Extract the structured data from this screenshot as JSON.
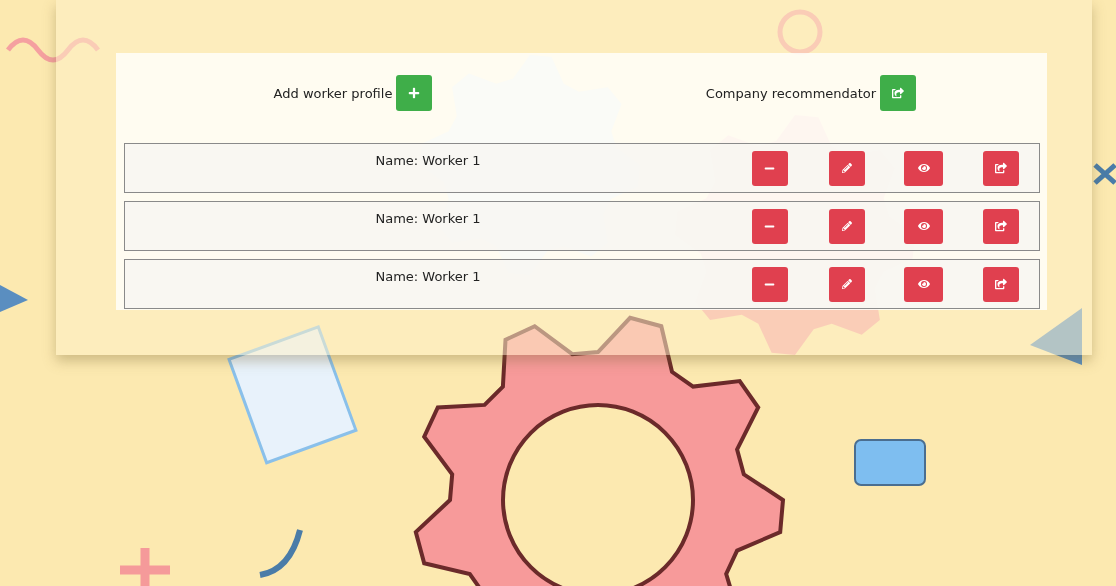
{
  "header": [
    {
      "label": "Add worker profile",
      "kind": "add"
    },
    {
      "label": "Company recommendator",
      "kind": "share"
    }
  ],
  "workers": [
    {
      "name": "Name: Worker 1"
    },
    {
      "name": "Name: Worker 1"
    },
    {
      "name": "Name: Worker 1"
    }
  ]
}
